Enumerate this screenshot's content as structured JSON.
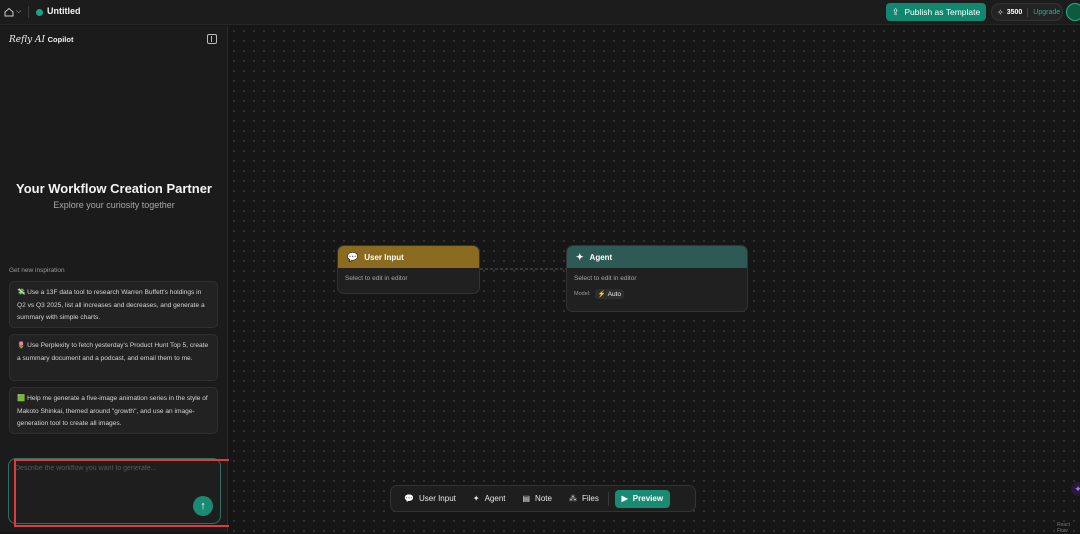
{
  "topbar": {
    "title": "Untitled",
    "publish_label": "Publish as Template",
    "credits": "3500",
    "upgrade_label": "Upgrade",
    "accent": "#12876f"
  },
  "sidebar": {
    "brand_italic": "Refly AI",
    "brand_copilot": "Copilot",
    "hero_title": "Your Workflow Creation Partner",
    "hero_subtitle": "Explore your curiosity together",
    "inspiration_label": "Get new inspiration",
    "inspirations": [
      {
        "emoji": "💸",
        "text": "Use a 13F data tool to research Warren Buffett's holdings in Q2 vs Q3 2025, list all increases and decreases, and generate a summary with simple charts."
      },
      {
        "emoji": "🌷",
        "text": "Use Perplexity to fetch yesterday's Product Hunt Top 5, create a summary document and a podcast, and email them to me."
      },
      {
        "emoji": "🟩",
        "text": "Help me generate a five-image animation series in the style of Makoto Shinkai, themed around \"growth\", and use an image-generation tool to create all images."
      }
    ],
    "input_placeholder": "Describe the workflow you want to generate..."
  },
  "canvas": {
    "nodes": {
      "user_input": {
        "title": "User Input",
        "body": "Select to edit in editor",
        "color": "#8a6b1f"
      },
      "agent": {
        "title": "Agent",
        "body": "Select to edit in editor",
        "model_label": "Model:",
        "model_value": "Auto",
        "color": "#2d5a55"
      }
    },
    "attribution": "React Flow"
  },
  "toolbar": {
    "items": [
      {
        "label": "User Input",
        "icon": "chat-bubble-icon"
      },
      {
        "label": "Agent",
        "icon": "sparkle-icon"
      },
      {
        "label": "Note",
        "icon": "note-icon"
      },
      {
        "label": "Files",
        "icon": "files-icon"
      }
    ],
    "preview_label": "Preview"
  }
}
